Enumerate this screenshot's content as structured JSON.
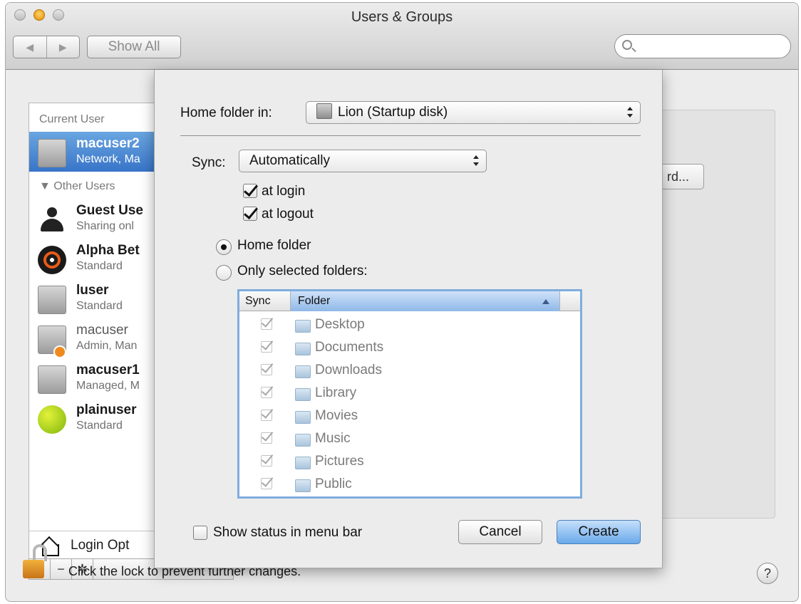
{
  "window": {
    "title": "Users & Groups"
  },
  "toolbar": {
    "back_label": "◀",
    "forward_label": "▶",
    "show_all_label": "Show All",
    "search_placeholder": ""
  },
  "user_list": {
    "current_user_header": "Current User",
    "other_users_header": "▼ Other Users",
    "current_user": {
      "name": "macuser2",
      "role": "Network, Ma"
    },
    "other_users": [
      {
        "name": "Guest Use",
        "role": "Sharing onl"
      },
      {
        "name": "Alpha Bet",
        "role": "Standard"
      },
      {
        "name": "luser",
        "role": "Standard"
      },
      {
        "name": "macuser",
        "role": "Admin, Man"
      },
      {
        "name": "macuser1",
        "role": "Managed, M"
      },
      {
        "name": "plainuser",
        "role": "Standard"
      }
    ],
    "login_options_label": "Login Opt",
    "add_label": "+",
    "remove_label": "−",
    "gear_label": "✲"
  },
  "background_pane": {
    "change_password_label": "rd..."
  },
  "lock": {
    "message": "Click the lock to prevent further changes."
  },
  "help_label": "?",
  "sheet": {
    "home_folder_label": "Home folder in:",
    "home_folder_value": "Lion (Startup disk)",
    "sync_label": "Sync:",
    "sync_value": "Automatically",
    "at_login_label": "at login",
    "at_login_checked": true,
    "at_logout_label": "at logout",
    "at_logout_checked": true,
    "radio_home_label": "Home folder",
    "radio_selected_label": "Only selected folders:",
    "selected_option": "Home folder",
    "table": {
      "col_sync": "Sync",
      "col_folder": "Folder",
      "rows": [
        {
          "name": "Desktop",
          "checked": true
        },
        {
          "name": "Documents",
          "checked": true
        },
        {
          "name": "Downloads",
          "checked": true
        },
        {
          "name": "Library",
          "checked": true
        },
        {
          "name": "Movies",
          "checked": true
        },
        {
          "name": "Music",
          "checked": true
        },
        {
          "name": "Pictures",
          "checked": true
        },
        {
          "name": "Public",
          "checked": true
        }
      ]
    },
    "show_status_label": "Show status in menu bar",
    "show_status_checked": false,
    "cancel_label": "Cancel",
    "create_label": "Create"
  }
}
